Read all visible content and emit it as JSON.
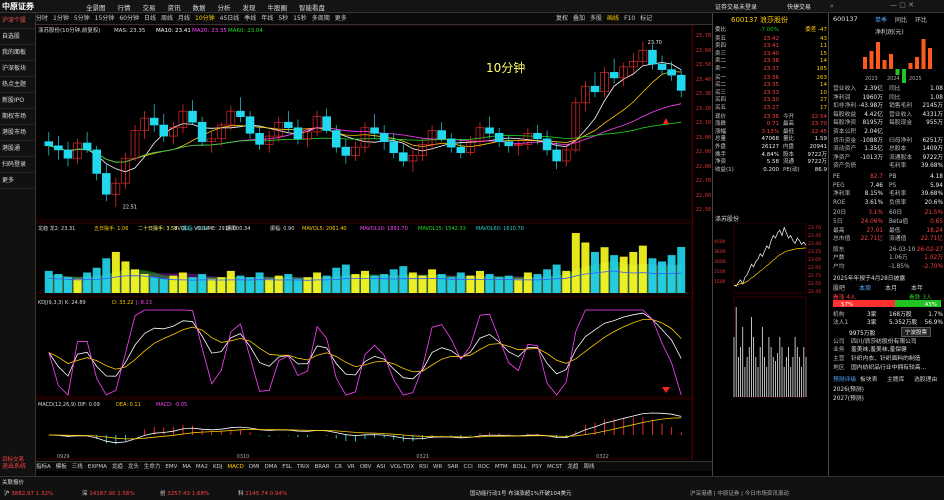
{
  "app": {
    "logo": "中原证券",
    "menu": [
      "全景图",
      "行情",
      "交易",
      "资讯",
      "数据",
      "分析",
      "发现",
      "牛股圈",
      "智能看盘"
    ],
    "account_label": "证券交易未登录",
    "trade_label": "快捷交易"
  },
  "left_nav": [
    "沪深个股",
    "自选股",
    "我的面板",
    "沪深板块",
    "热点主题",
    "新股IPO",
    "期权市场",
    "港股市场",
    "港股通",
    "扫码登录",
    "更多"
  ],
  "period_tabs": [
    "分时",
    "1分钟",
    "5分钟",
    "15分钟",
    "60分钟",
    "日线",
    "周线",
    "月线",
    "10分钟",
    "45日线",
    "季线",
    "年线",
    "5秒",
    "15秒",
    "多周期",
    "更多"
  ],
  "active_period": "10分钟",
  "right_tabs": [
    "复权",
    "叠加",
    "多股",
    "画线",
    "F10",
    "标记"
  ],
  "chart": {
    "title": "涤苏股份(10分钟,前复权)",
    "ma_label": "MAS: 23.35",
    "ma": [
      {
        "label": "MA10: 23.41",
        "color": "#ffffff"
      },
      {
        "label": "MA20: 23.35",
        "color": "#ff44ff"
      },
      {
        "label": "MA60: 23.04",
        "color": "#22dd22"
      }
    ],
    "watermark": "10分钟",
    "high_label": "23.70",
    "low_label": "22.51",
    "candles": [
      [
        22.98,
        23.05,
        22.88,
        22.95
      ],
      [
        22.95,
        23.02,
        22.85,
        22.92
      ],
      [
        22.92,
        22.98,
        22.8,
        22.86
      ],
      [
        22.86,
        23.0,
        22.82,
        22.97
      ],
      [
        22.97,
        23.05,
        22.9,
        22.92
      ],
      [
        22.92,
        22.95,
        22.7,
        22.75
      ],
      [
        22.75,
        22.82,
        22.55,
        22.6
      ],
      [
        22.6,
        22.72,
        22.51,
        22.68
      ],
      [
        22.68,
        22.9,
        22.64,
        22.86
      ],
      [
        22.86,
        23.1,
        22.84,
        23.06
      ],
      [
        23.06,
        23.2,
        23.0,
        23.15
      ],
      [
        23.15,
        23.25,
        23.05,
        23.1
      ],
      [
        23.1,
        23.18,
        22.98,
        23.02
      ],
      [
        23.02,
        23.12,
        22.96,
        23.08
      ],
      [
        23.08,
        23.25,
        23.04,
        23.2
      ],
      [
        23.2,
        23.28,
        23.1,
        23.12
      ],
      [
        23.12,
        23.16,
        22.95,
        22.98
      ],
      [
        22.98,
        23.05,
        22.9,
        23.0
      ],
      [
        23.0,
        23.12,
        22.95,
        23.1
      ],
      [
        23.1,
        23.24,
        23.06,
        23.2
      ],
      [
        23.2,
        23.3,
        23.12,
        23.16
      ],
      [
        23.16,
        23.2,
        23.0,
        23.04
      ],
      [
        23.04,
        23.1,
        22.92,
        22.96
      ],
      [
        22.96,
        23.06,
        22.9,
        23.02
      ],
      [
        23.02,
        23.16,
        22.98,
        23.12
      ],
      [
        23.12,
        23.2,
        23.05,
        23.08
      ],
      [
        23.08,
        23.14,
        22.96,
        23.0
      ],
      [
        23.0,
        23.08,
        22.94,
        23.05
      ],
      [
        23.05,
        23.2,
        23.02,
        23.16
      ],
      [
        23.16,
        23.22,
        23.04,
        23.06
      ],
      [
        23.06,
        23.1,
        22.9,
        22.94
      ],
      [
        22.94,
        23.0,
        22.82,
        22.88
      ],
      [
        22.88,
        22.98,
        22.84,
        22.94
      ],
      [
        22.94,
        23.12,
        22.9,
        23.08
      ],
      [
        23.08,
        23.18,
        23.0,
        23.04
      ],
      [
        23.04,
        23.1,
        22.92,
        22.98
      ],
      [
        22.98,
        23.04,
        22.86,
        22.9
      ],
      [
        22.9,
        22.96,
        22.8,
        22.84
      ],
      [
        22.84,
        22.92,
        22.76,
        22.88
      ],
      [
        22.88,
        23.0,
        22.84,
        22.96
      ],
      [
        22.96,
        23.1,
        22.92,
        23.06
      ],
      [
        23.06,
        23.12,
        22.98,
        23.0
      ],
      [
        23.0,
        23.04,
        22.9,
        22.94
      ],
      [
        22.94,
        23.0,
        22.86,
        22.9
      ],
      [
        22.9,
        23.02,
        22.88,
        22.98
      ],
      [
        22.98,
        23.12,
        22.94,
        23.08
      ],
      [
        23.08,
        23.16,
        23.0,
        23.04
      ],
      [
        23.04,
        23.08,
        22.94,
        22.98
      ],
      [
        22.98,
        23.02,
        22.9,
        22.95
      ],
      [
        22.95,
        23.0,
        22.88,
        22.96
      ],
      [
        22.96,
        23.08,
        22.92,
        23.04
      ],
      [
        23.04,
        23.1,
        22.96,
        23.0
      ],
      [
        23.0,
        23.06,
        22.88,
        22.92
      ],
      [
        22.92,
        22.98,
        22.78,
        22.84
      ],
      [
        22.84,
        22.96,
        22.8,
        22.92
      ],
      [
        22.92,
        23.3,
        22.9,
        23.26
      ],
      [
        23.26,
        23.42,
        23.2,
        23.38
      ],
      [
        23.38,
        23.48,
        23.3,
        23.34
      ],
      [
        23.34,
        23.52,
        23.3,
        23.48
      ],
      [
        23.48,
        23.58,
        23.4,
        23.44
      ],
      [
        23.44,
        23.55,
        23.38,
        23.52
      ],
      [
        23.52,
        23.62,
        23.46,
        23.56
      ],
      [
        23.56,
        23.7,
        23.52,
        23.64
      ],
      [
        23.64,
        23.68,
        23.5,
        23.54
      ],
      [
        23.54,
        23.6,
        23.46,
        23.5
      ],
      [
        23.5,
        23.56,
        23.42,
        23.46
      ],
      [
        23.46,
        23.5,
        23.3,
        23.35
      ]
    ],
    "vol_title": "VVOL: - VOLUME: 2914.00",
    "vol_items": [
      "MAVOL5: 2061.40",
      "MAVOL10: 1891.70",
      "MAVOL15: 1542.33",
      "MAVOL60: 1610.70"
    ],
    "dragon_label": "龙趋 龙2: 23.31",
    "dragon_items": [
      "五日操手: 1.06",
      "二十日操手: 3.58",
      "振幅: -0.34",
      "振阳: 0.34",
      "振幅: 0.90"
    ],
    "volumes": [
      1400,
      1200,
      1000,
      900,
      1300,
      1600,
      2200,
      2600,
      2000,
      1500,
      1200,
      1000,
      900,
      1100,
      1300,
      1000,
      1200,
      900,
      1000,
      1400,
      1100,
      1000,
      1300,
      900,
      1100,
      1200,
      900,
      1000,
      1300,
      1100,
      1600,
      1800,
      1200,
      1400,
      1100,
      1200,
      1500,
      1700,
      1300,
      1100,
      1500,
      1200,
      1000,
      1300,
      1100,
      1400,
      1200,
      1000,
      1100,
      900,
      1300,
      1200,
      1500,
      1800,
      1400,
      3800,
      3200,
      2600,
      2900,
      2400,
      2300,
      2600,
      3000,
      2200,
      2000,
      2400,
      2914
    ],
    "kdj_label": "KDJ(9,3,3) K: 24.89",
    "kdj_d": "D: 33.22",
    "kdj_j": "J: 8.23",
    "macd_label": "MACD(12,26,9) DIF: 0.09",
    "macd_dea": "DEA: 0.11",
    "macd_val": "MACD: -0.05",
    "time_labels": [
      "0929",
      "0310",
      "0321",
      "0322"
    ]
  },
  "yaxis_ticks": [
    "23.70",
    "23.60",
    "23.50",
    "23.40",
    "23.30",
    "23.20",
    "23.10",
    "23.00",
    "22.90",
    "22.80",
    "22.70",
    "22.60",
    "22.50"
  ],
  "indicator_tabs": [
    "指标A",
    "模板",
    "三线",
    "EXPMA",
    "龙趋",
    "龙头",
    "生命力",
    "EMV",
    "MA",
    "MA2",
    "KDJ",
    "MACD",
    "DMI",
    "DMA",
    "FSL",
    "TRIX",
    "BRAR",
    "CR",
    "VR",
    "OBV",
    "ASI",
    "VOL-TDX",
    "RSI",
    "WR",
    "SAR",
    "CCI",
    "ROC",
    "MTM",
    "BOLL",
    "PSY",
    "MCST",
    "龙趋",
    "周线"
  ],
  "active_indicator": "MACD",
  "quote": {
    "code": "600137",
    "name": "浪莎股份",
    "wb_label": "委比",
    "wb": "-7.00%",
    "wc_label": "委差",
    "wc": "-47",
    "asks": [
      [
        "卖五",
        "23.42",
        "43"
      ],
      [
        "卖四",
        "23.41",
        "11"
      ],
      [
        "卖三",
        "23.40",
        "15"
      ],
      [
        "卖二",
        "23.38",
        "14"
      ],
      [
        "卖一",
        "23.37",
        "185"
      ]
    ],
    "bids": [
      [
        "买一",
        "23.36",
        "263"
      ],
      [
        "买二",
        "23.35",
        "14"
      ],
      [
        "买三",
        "23.33",
        "10"
      ],
      [
        "买四",
        "23.30",
        "27"
      ],
      [
        "买五",
        "23.27",
        "17"
      ]
    ],
    "stats": [
      [
        "现价",
        "23.36",
        "今开",
        "22.54"
      ],
      [
        "涨跌",
        "0.71",
        "最高",
        "23.70"
      ],
      [
        "涨幅",
        "3.13%",
        "最低",
        "22.45"
      ],
      [
        "总量",
        "47068",
        "量比",
        "1.59"
      ],
      [
        "外盘",
        "26127",
        "内盘",
        "20941"
      ],
      [
        "换手",
        "4.84%",
        "股本",
        "9722万"
      ],
      [
        "净资",
        "5.58",
        "流通",
        "9722万"
      ],
      [
        "收益(1)",
        "0.200",
        "PE(动)",
        "86.9"
      ]
    ],
    "mini_title": "涤苏股份",
    "mini_ticks": [
      "23.70",
      "23.45",
      "23.40",
      "23.25",
      "23.00",
      "22.95",
      "22.75",
      "22.55",
      "22.45"
    ],
    "mini_vol_ticks": [
      "4500",
      "3600",
      "3000",
      "2500",
      "1500"
    ],
    "mini_price": [
      22.6,
      22.58,
      22.65,
      22.7,
      22.62,
      22.75,
      22.8,
      22.9,
      23.0,
      22.95,
      23.05,
      23.1,
      23.2,
      23.15,
      23.25,
      23.35,
      23.3,
      23.45,
      23.55,
      23.5,
      23.6,
      23.65,
      23.55,
      23.7,
      23.6,
      23.5,
      23.55,
      23.45,
      23.4,
      23.5,
      23.45,
      23.38,
      23.42,
      23.36
    ],
    "mini_avg": [
      22.6,
      22.6,
      22.61,
      22.63,
      22.63,
      22.65,
      22.67,
      22.7,
      22.74,
      22.76,
      22.8,
      22.83,
      22.87,
      22.9,
      22.93,
      22.97,
      23.0,
      23.04,
      23.08,
      23.11,
      23.15,
      23.18,
      23.2,
      23.23,
      23.25,
      23.26,
      23.27,
      23.28,
      23.29,
      23.3,
      23.3,
      23.3,
      23.31,
      23.31
    ],
    "mini_vols": [
      30,
      45,
      20,
      25,
      35,
      15,
      20,
      25,
      40,
      30,
      20,
      15,
      25,
      35,
      20,
      15,
      30,
      25,
      20,
      18,
      22,
      30,
      25,
      15,
      20,
      25,
      15,
      20,
      30,
      25,
      20,
      15,
      25,
      20
    ]
  },
  "finance": {
    "code": "600137",
    "tabs": [
      "单季",
      "同比",
      "环比"
    ],
    "chart_title": "净利润(元)",
    "net_profit": [
      {
        "year": "2023",
        "value": 1
      },
      {
        "year": "2024",
        "value": -1
      },
      {
        "year": "2025",
        "value": 3
      }
    ],
    "bars": [
      0.4,
      0.6,
      0.9,
      0.3,
      0.5,
      -0.2,
      -0.5,
      0.2,
      0.4,
      1.0,
      0.7
    ],
    "rows": [
      [
        "营业收入",
        "2.39亿",
        "同比",
        "1.08"
      ],
      [
        "净利润",
        "1960万",
        "同比",
        "1.08"
      ],
      [
        "扣非净利",
        "-43.98万",
        "销售毛利",
        "2145万"
      ],
      [
        "每股收益",
        "4.42亿",
        "营业收入",
        "4331万"
      ],
      [
        "每股净资",
        "8195万",
        "每股现金",
        "955万"
      ],
      [
        "资本公积",
        "2.04亿",
        "",
        ""
      ],
      [
        "货币资金",
        "-1088万",
        "归母净利",
        "6251万"
      ],
      [
        "流动资产",
        "1.35亿",
        "总股本",
        "1409万"
      ],
      [
        "净资产",
        "-1013万",
        "流通股本",
        "9722万"
      ],
      [
        "资产负债",
        "",
        "毛利率",
        "39.68%"
      ]
    ],
    "pe": [
      [
        "PE",
        "82.7",
        "PB",
        "4.18"
      ],
      [
        "PEG",
        "7.46",
        "PS",
        "5.94"
      ],
      [
        "净利率",
        "8.15%",
        "毛利率",
        "39.68%"
      ],
      [
        "ROE",
        "3.61%",
        "负债率",
        "20.6%"
      ]
    ],
    "ratios": [
      [
        "20日",
        "3.1%",
        "60日",
        "21.5%"
      ],
      [
        "5日",
        "24.06%",
        "Beta值",
        "0.65"
      ],
      [
        "最高",
        "27.01",
        "最低",
        "18.24"
      ],
      [
        "总市值",
        "22.71亿",
        "流通值",
        "22.71亿"
      ]
    ],
    "holders": [
      [
        "股东",
        "",
        "26-03-10",
        "26-02-27"
      ],
      [
        "户数",
        "",
        "1.06万",
        "1.02万"
      ],
      [
        "户均",
        "",
        "-1.85%",
        "-2.70%"
      ]
    ],
    "report": "2025年年报于4月28日披露",
    "rating_tabs": [
      "股吧",
      "本周",
      "本月",
      "本年"
    ],
    "rating_sub": [
      "看涨",
      "4人",
      "看跌",
      "3人"
    ],
    "bull_pct": "57%",
    "bear_pct": "43%",
    "inst": [
      [
        "机构",
        "",
        "3家",
        "168万股",
        "1.7%"
      ],
      [
        "法人1",
        "",
        "3家",
        "5.352万股",
        "56.9%"
      ]
    ],
    "shares": "9975万股",
    "shares_note": "宁波股票",
    "profile": [
      [
        "公司",
        "四川/浪莎纺股份有限公司"
      ],
      [
        "业务",
        "羞美袜,羞美袜,羞保健"
      ],
      [
        "主营",
        "针织内衣、针织面料的制造"
      ],
      [
        "地区",
        "国内纺织品行业中拥有较高..."
      ]
    ],
    "predict_tabs": [
      "预测评级",
      "板块表",
      "主题库",
      "选股理由"
    ],
    "forecast": [
      [
        "2026(预测)",
        ""
      ],
      [
        "2027(预测)",
        ""
      ]
    ]
  },
  "status": {
    "index": [
      [
        "沪",
        "3882.97",
        "1.32%"
      ],
      [
        "深",
        "14187.90",
        "1.56%"
      ],
      [
        "创",
        "3257.43",
        "1.68%"
      ],
      [
        "科",
        "1145.74",
        "0.94%"
      ]
    ],
    "news": "国动能行动1号 布油涨超1%开破104美元",
    "ticker": "沪深港通 | 中原证券 | 今日市场资讯滚动"
  },
  "bottom_left": "目标交易",
  "bottom_left2": "关联报价"
}
